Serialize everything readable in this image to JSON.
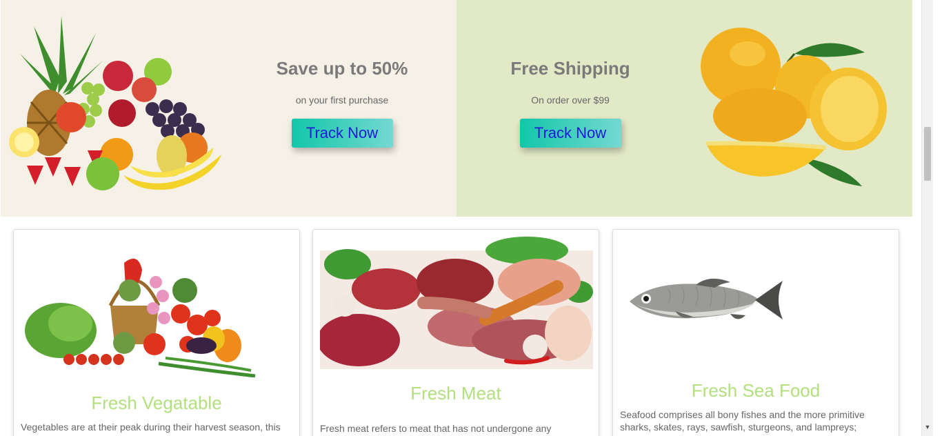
{
  "promos": [
    {
      "title": "Save up to 50%",
      "subtitle": "on your first purchase",
      "button_label": "Track Now",
      "background": "#f6f1e7"
    },
    {
      "title": "Free Shipping",
      "subtitle": "On order over $99",
      "button_label": "Track Now",
      "background": "#e2e9c6"
    }
  ],
  "categories": [
    {
      "title": "Fresh Vegatable",
      "description": "Vegetables are at their peak during their harvest season, this",
      "image": "vegetable-basket-image"
    },
    {
      "title": "Fresh Meat",
      "description": "Fresh meat refers to meat that has not undergone any",
      "image": "raw-meat-image"
    },
    {
      "title": "Fresh Sea Food",
      "description": "Seafood comprises all bony fishes and the more primitive sharks, skates, rays, sawfish, sturgeons, and lampreys;",
      "image": "fish-image"
    }
  ],
  "colors": {
    "button_gradient_start": "#12c7a8",
    "button_gradient_end": "#74d8d2",
    "button_text": "#1b1bd6",
    "card_title": "#b3e07e",
    "promo_title": "#7a7a7a"
  },
  "icons": {
    "scroll_up": "▲",
    "scroll_down": "▼"
  }
}
